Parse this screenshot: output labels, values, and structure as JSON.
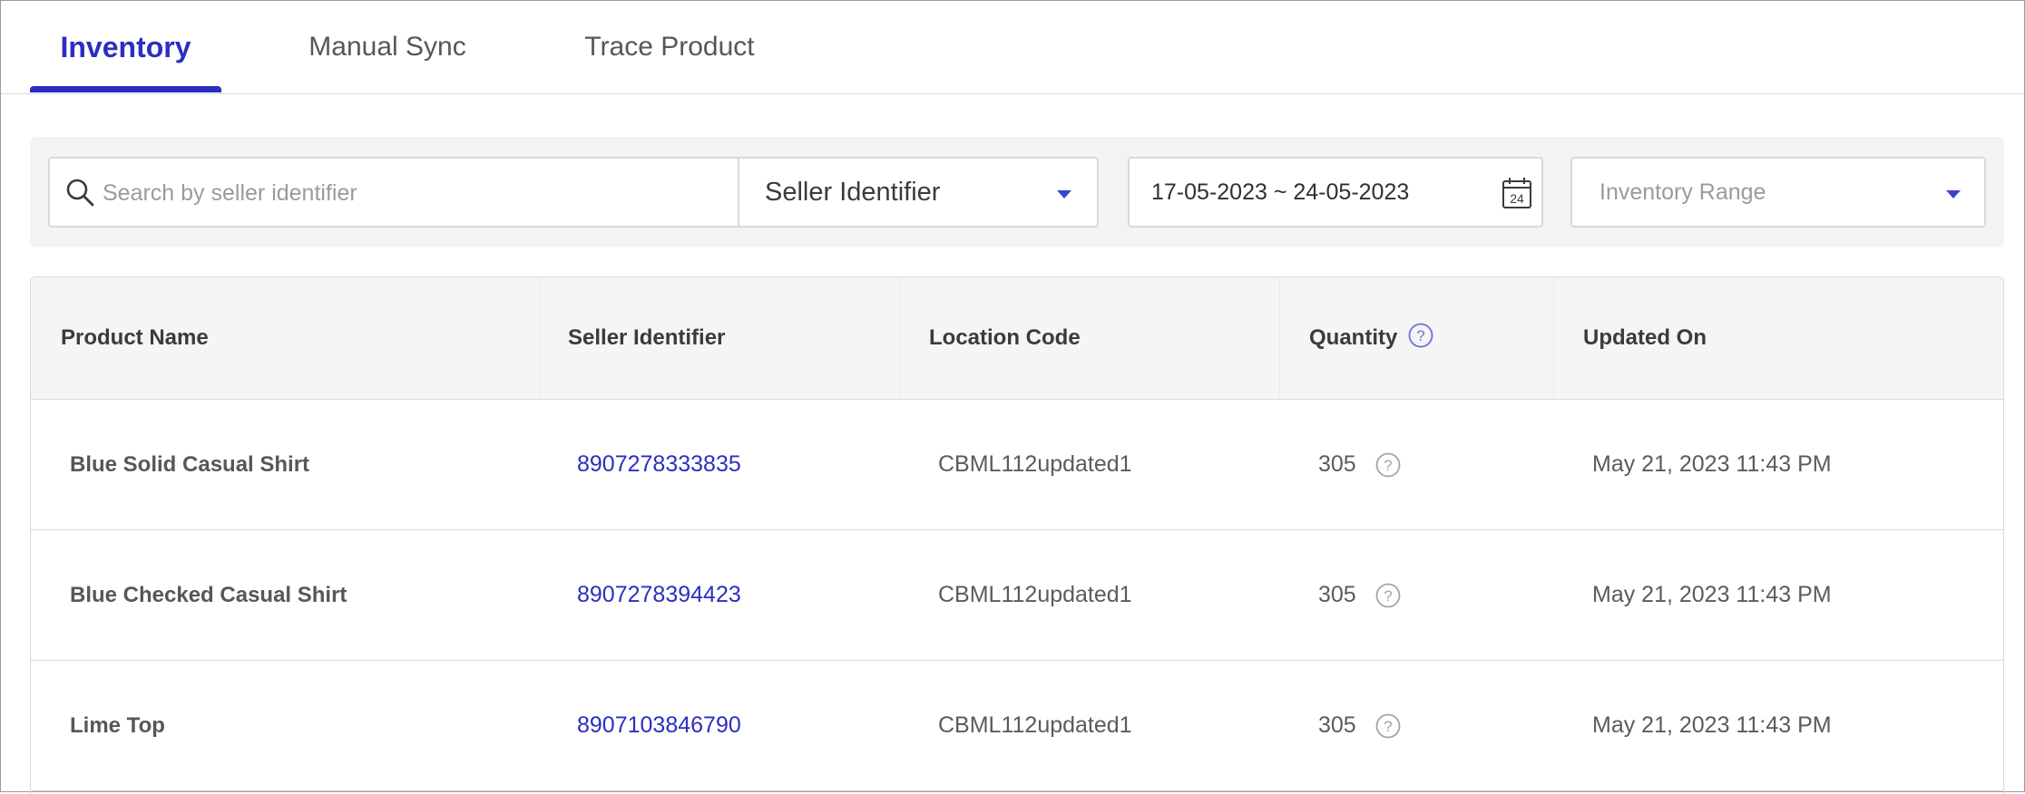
{
  "tabs": [
    {
      "label": "Inventory",
      "active": true
    },
    {
      "label": "Manual Sync",
      "active": false
    },
    {
      "label": "Trace Product",
      "active": false
    }
  ],
  "filters": {
    "search_placeholder": "Search by seller identifier",
    "search_value": "",
    "identifier_select": "Seller Identifier",
    "date_range": "17-05-2023 ~ 24-05-2023",
    "calendar_day": "24",
    "inventory_range_placeholder": "Inventory Range"
  },
  "table": {
    "headers": {
      "product_name": "Product Name",
      "seller_identifier": "Seller Identifier",
      "location_code": "Location Code",
      "quantity": "Quantity",
      "updated_on": "Updated On"
    },
    "rows": [
      {
        "product_name": "Blue Solid Casual Shirt",
        "seller_identifier": "8907278333835",
        "location_code": "CBML112updated1",
        "quantity": "305",
        "updated_on": "May 21, 2023 11:43 PM"
      },
      {
        "product_name": "Blue Checked Casual Shirt",
        "seller_identifier": "8907278394423",
        "location_code": "CBML112updated1",
        "quantity": "305",
        "updated_on": "May 21, 2023 11:43 PM"
      },
      {
        "product_name": "Lime Top",
        "seller_identifier": "8907103846790",
        "location_code": "CBML112updated1",
        "quantity": "305",
        "updated_on": "May 21, 2023 11:43 PM"
      }
    ]
  },
  "colors": {
    "accent": "#2b2fbf",
    "header_bg": "#f5f5f5",
    "filter_bg": "#f3f3f3",
    "border": "#d9d9d9"
  }
}
